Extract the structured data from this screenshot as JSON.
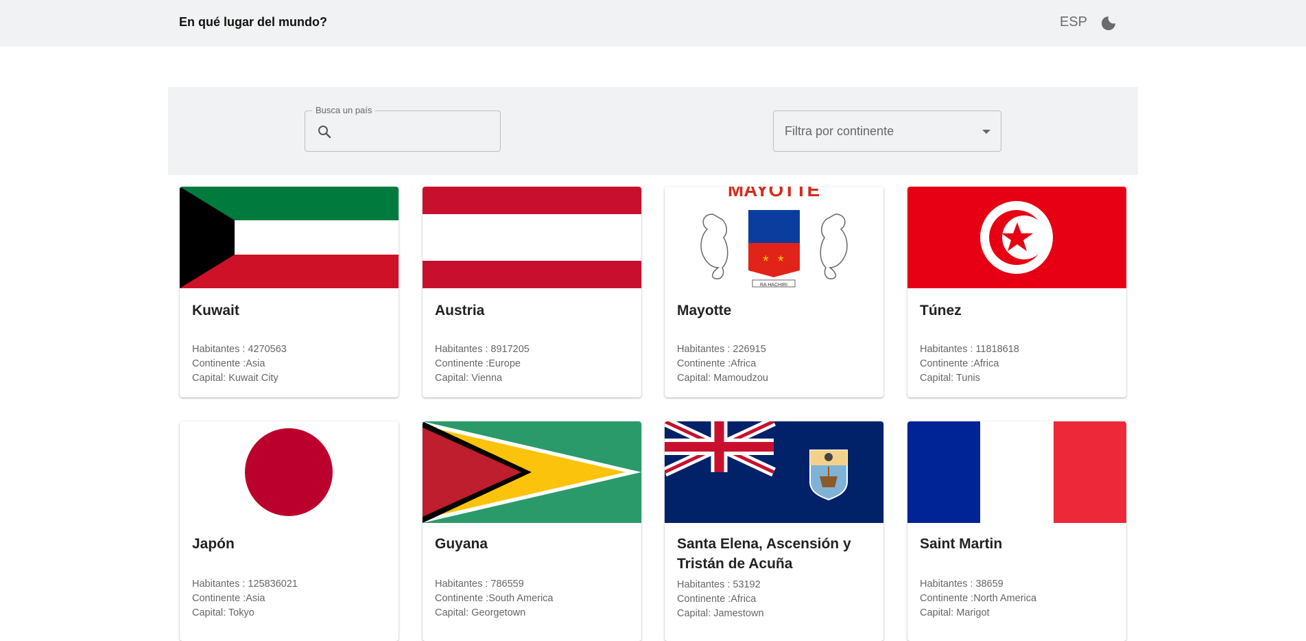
{
  "header": {
    "title": "En qué lugar del mundo?",
    "language": "ESP",
    "theme_icon": "moon-icon"
  },
  "filters": {
    "search_label": "Busca un país",
    "search_value": "",
    "search_icon": "search-icon",
    "continent_placeholder": "Filtra por continente",
    "dropdown_icon": "caret-down-icon"
  },
  "countries": [
    {
      "name": "Kuwait",
      "population": "Habitantes : 4270563",
      "continent": "Continente :Asia",
      "capital": "Capital: Kuwait City"
    },
    {
      "name": "Austria",
      "population": "Habitantes : 8917205",
      "continent": "Continente :Europe",
      "capital": "Capital: Vienna"
    },
    {
      "name": "Mayotte",
      "population": "Habitantes : 226915",
      "continent": "Continente :Africa",
      "capital": "Capital: Mamoudzou",
      "flag_text": "MAYOTTE",
      "flag_motto": "RA HACHIRI"
    },
    {
      "name": "Túnez",
      "population": "Habitantes : 11818618",
      "continent": "Continente :Africa",
      "capital": "Capital: Tunis"
    },
    {
      "name": "Japón",
      "population": "Habitantes : 125836021",
      "continent": "Continente :Asia",
      "capital": "Capital: Tokyo"
    },
    {
      "name": "Guyana",
      "population": "Habitantes : 786559",
      "continent": "Continente :South America",
      "capital": "Capital: Georgetown"
    },
    {
      "name": "Santa Elena, Ascensión y Tristán de Acuña",
      "population": "Habitantes : 53192",
      "continent": "Continente :Africa",
      "capital": "Capital: Jamestown"
    },
    {
      "name": "Saint Martin",
      "population": "Habitantes : 38659",
      "continent": "Continente :North America",
      "capital": "Capital: Marigot"
    }
  ]
}
